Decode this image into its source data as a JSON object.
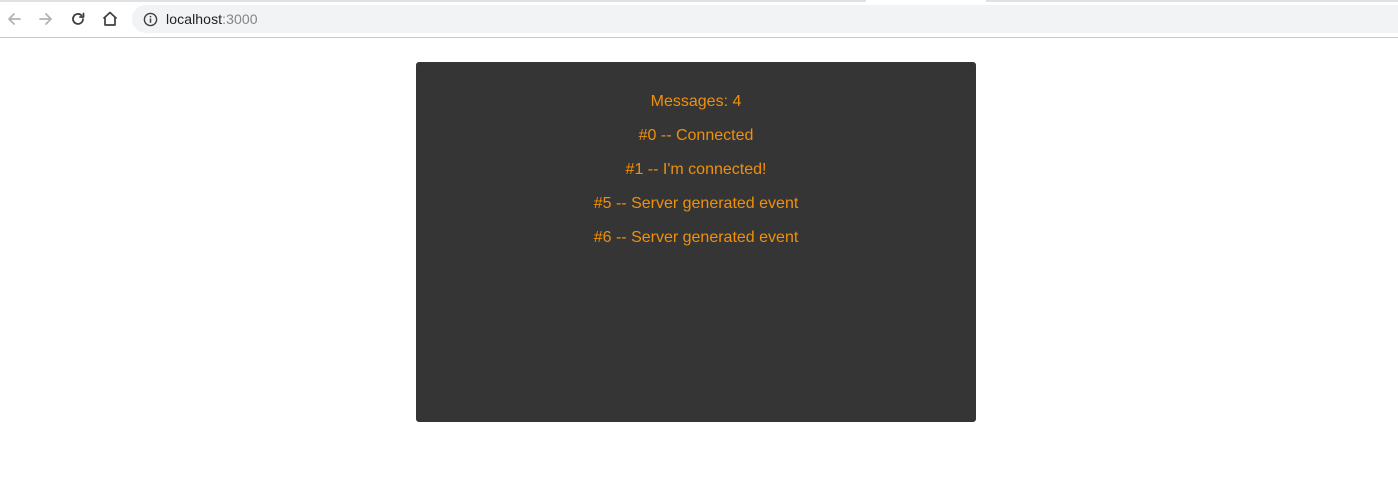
{
  "browser": {
    "url_host": "localhost",
    "url_port": ":3000",
    "back_icon": "arrow-left-icon",
    "forward_icon": "arrow-right-icon",
    "reload_icon": "reload-icon",
    "home_icon": "home-icon",
    "info_icon": "info-icon"
  },
  "app": {
    "header": "Messages: 4",
    "messages": [
      "#0 -- Connected",
      "#1 -- I'm connected!",
      "#5 -- Server generated event",
      "#6 -- Server generated event"
    ],
    "panel_color": "#353535",
    "text_color": "#f0900a"
  }
}
